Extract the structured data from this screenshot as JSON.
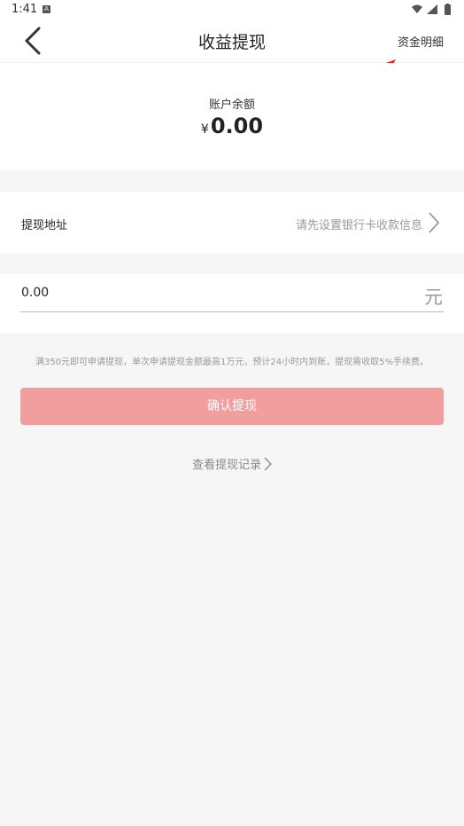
{
  "status_bar": {
    "time": "1:41",
    "notification_badge": "A"
  },
  "header": {
    "title": "收益提现",
    "right_link": "资金明细",
    "icons": {
      "back": "back-arrow-icon"
    }
  },
  "balance": {
    "label": "账户余额",
    "currency": "¥",
    "amount": "0.00"
  },
  "address": {
    "label": "提现地址",
    "value": "请先设置银行卡收款信息"
  },
  "amount": {
    "value": "0.00",
    "unit": "元"
  },
  "notice": "满350元即可申请提现，单次申请提现金额最高1万元，预计24小时内到账，提现需收取5%手续费。",
  "confirm_button": {
    "label": "确认提现"
  },
  "records_link": {
    "label": "查看提现记录"
  },
  "colors": {
    "accent_button": "#f29e9e",
    "annotation_arrow": "#e8211c",
    "background": "#f5f6f5"
  }
}
